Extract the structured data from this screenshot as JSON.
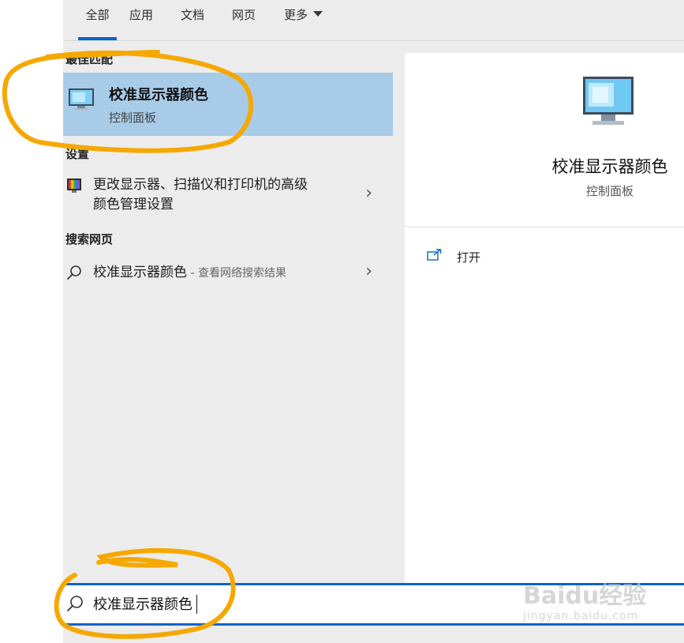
{
  "tabs": [
    {
      "label": "全部"
    },
    {
      "label": "应用"
    },
    {
      "label": "文档"
    },
    {
      "label": "网页"
    },
    {
      "label": "更多"
    }
  ],
  "best_match": {
    "section_title": "最佳匹配",
    "title": "校准显示器颜色",
    "subtitle": "控制面板"
  },
  "settings": {
    "section_title": "设置",
    "item_line1": "更改显示器、扫描仪和打印机的高级",
    "item_line2": "颜色管理设置"
  },
  "web": {
    "section_title": "搜索网页",
    "query": "校准显示器颜色",
    "hint": " - 查看网络搜索结果"
  },
  "preview": {
    "title": "校准显示器颜色",
    "subtitle": "控制面板",
    "open_label": "打开"
  },
  "search": {
    "value": "校准显示器颜色"
  },
  "watermark": {
    "brand": "Baidu经验",
    "url": "jingyan.baidu.com"
  },
  "colors": {
    "accent": "#0a64c8",
    "highlight": "#a8cbe8",
    "annotation": "#f5a800"
  },
  "icons": {
    "monitor": "monitor-icon",
    "color_settings": "color-management-icon",
    "search": "search-icon",
    "open": "open-icon",
    "chevron": "chevron-right-icon"
  }
}
